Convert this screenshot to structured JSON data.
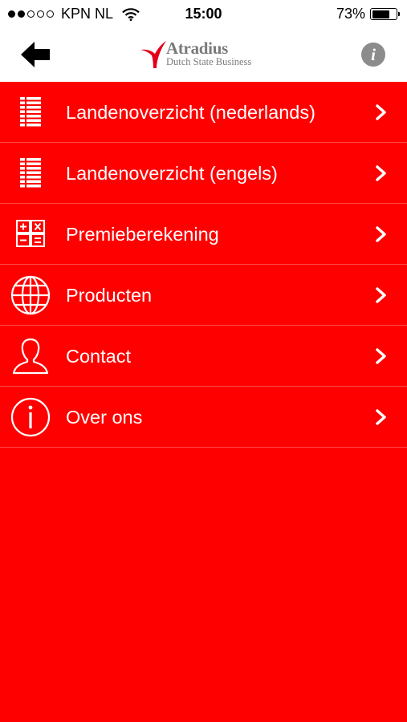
{
  "status_bar": {
    "carrier": "KPN NL",
    "time": "15:00",
    "battery_percent": "73%",
    "battery_level": 0.73,
    "signal_bars_filled": 2,
    "signal_bars_total": 5
  },
  "nav": {
    "back_icon": "arrow-left-icon",
    "logo_title": "Atradius",
    "logo_subtitle": "Dutch State Business",
    "info_label": "i"
  },
  "colors": {
    "brand_red": "#fe0000",
    "logo_red": "#e3001b",
    "logo_gray": "#7a7a7a"
  },
  "menu": {
    "items": [
      {
        "label": "Landenoverzicht (nederlands)",
        "icon": "list-document-icon"
      },
      {
        "label": "Landenoverzicht (engels)",
        "icon": "list-document-icon"
      },
      {
        "label": "Premieberekening",
        "icon": "calculator-icon"
      },
      {
        "label": "Producten",
        "icon": "globe-icon"
      },
      {
        "label": "Contact",
        "icon": "person-icon"
      },
      {
        "label": "Over ons",
        "icon": "info-circle-icon"
      }
    ]
  }
}
